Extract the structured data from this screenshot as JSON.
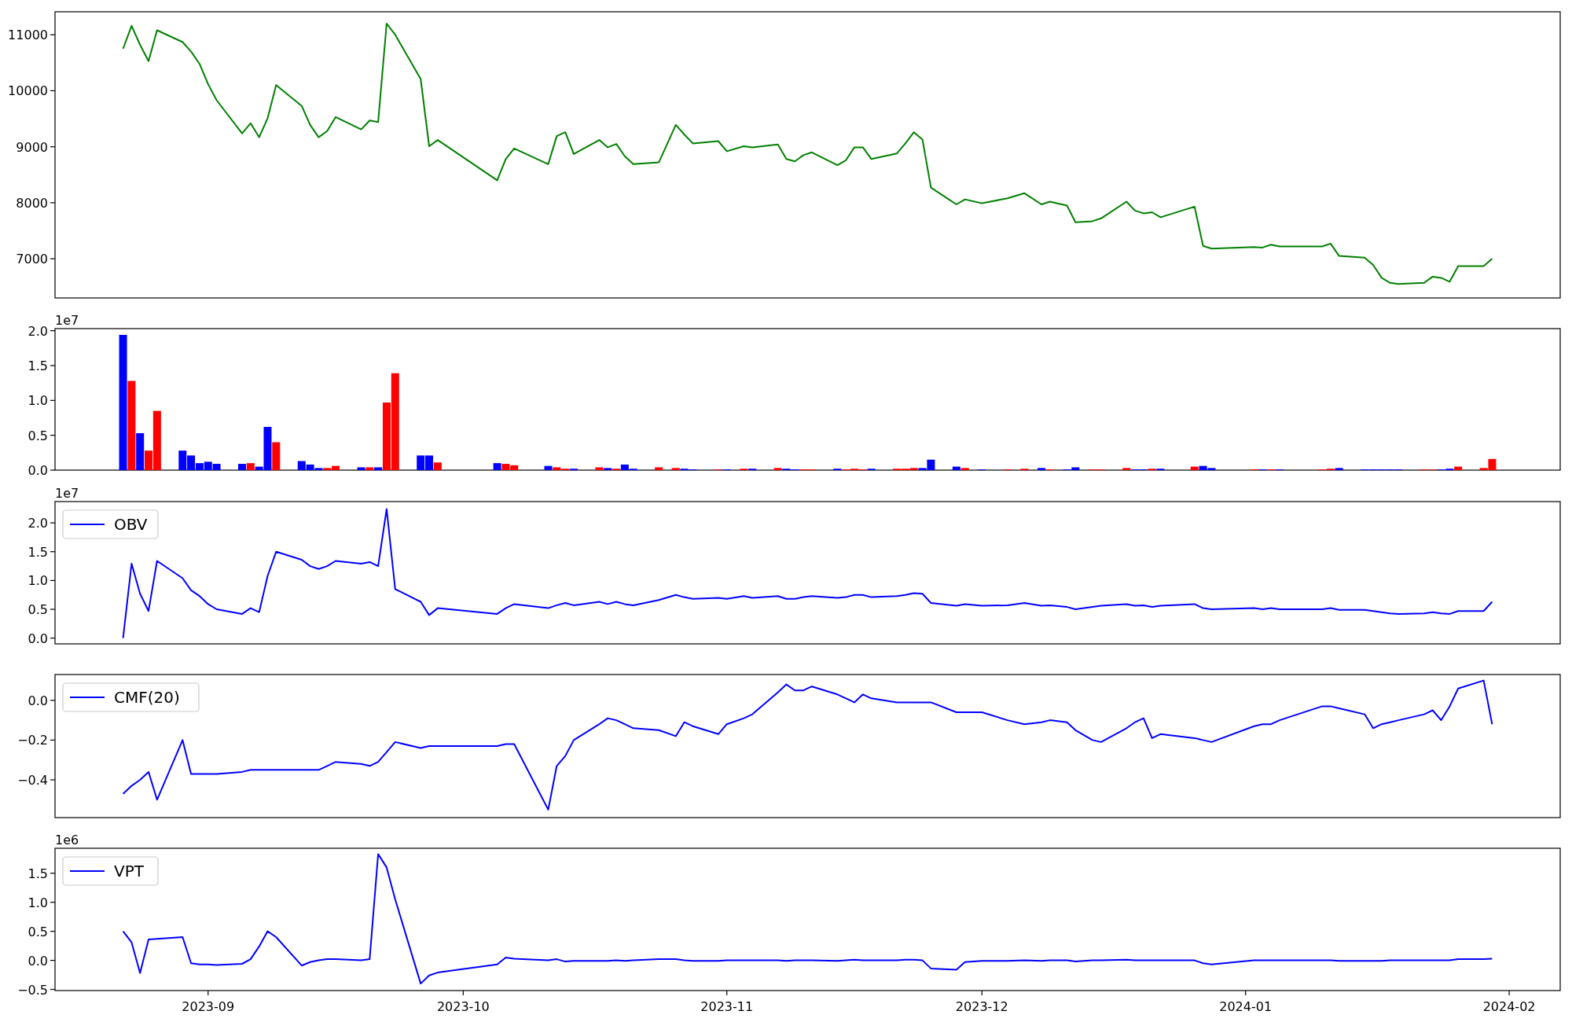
{
  "figure": {
    "panels": [
      {
        "chart_data": {
          "type": "line",
          "xlim": [
            "2023-08-14",
            "2024-02-07"
          ],
          "ylim": [
            6300,
            11410
          ],
          "yticks": [
            7000,
            8000,
            9000,
            10000,
            11000
          ],
          "x": [
            "2023-08-22",
            "2023-08-23",
            "2023-08-24",
            "2023-08-25",
            "2023-08-26",
            "2023-08-29",
            "2023-08-30",
            "2023-08-31",
            "2023-09-01",
            "2023-09-02",
            "2023-09-05",
            "2023-09-06",
            "2023-09-07",
            "2023-09-08",
            "2023-09-09",
            "2023-09-12",
            "2023-09-13",
            "2023-09-14",
            "2023-09-15",
            "2023-09-16",
            "2023-09-19",
            "2023-09-20",
            "2023-09-21",
            "2023-09-22",
            "2023-09-23",
            "2023-09-26",
            "2023-09-27",
            "2023-09-28",
            "2023-10-05",
            "2023-10-06",
            "2023-10-07",
            "2023-10-11",
            "2023-10-12",
            "2023-10-13",
            "2023-10-14",
            "2023-10-17",
            "2023-10-18",
            "2023-10-19",
            "2023-10-20",
            "2023-10-21",
            "2023-10-24",
            "2023-10-26",
            "2023-10-27",
            "2023-10-28",
            "2023-10-31",
            "2023-11-01",
            "2023-11-03",
            "2023-11-04",
            "2023-11-07",
            "2023-11-08",
            "2023-11-09",
            "2023-11-10",
            "2023-11-11",
            "2023-11-14",
            "2023-11-15",
            "2023-11-16",
            "2023-11-17",
            "2023-11-18",
            "2023-11-21",
            "2023-11-22",
            "2023-11-23",
            "2023-11-24",
            "2023-11-25",
            "2023-11-28",
            "2023-11-29",
            "2023-12-01",
            "2023-12-04",
            "2023-12-06",
            "2023-12-08",
            "2023-12-09",
            "2023-12-11",
            "2023-12-12",
            "2023-12-14",
            "2023-12-15",
            "2023-12-18",
            "2023-12-19",
            "2023-12-20",
            "2023-12-21",
            "2023-12-22",
            "2023-12-26",
            "2023-12-27",
            "2023-12-28",
            "2024-01-02",
            "2024-01-03",
            "2024-01-04",
            "2024-01-05",
            "2024-01-10",
            "2024-01-11",
            "2024-01-12",
            "2024-01-15",
            "2024-01-16",
            "2024-01-17",
            "2024-01-18",
            "2024-01-19",
            "2024-01-22",
            "2024-01-23",
            "2024-01-24",
            "2024-01-25",
            "2024-01-26",
            "2024-01-29",
            "2024-01-30"
          ],
          "series": [
            {
              "color": "#008000",
              "values": [
                10750,
                11160,
                10820,
                10530,
                11080,
                10870,
                10700,
                10480,
                10120,
                9830,
                9240,
                9420,
                9170,
                9510,
                10100,
                9730,
                9390,
                9170,
                9280,
                9530,
                9310,
                9470,
                9440,
                11200,
                11000,
                10210,
                9010,
                9120,
                8400,
                8780,
                8970,
                8690,
                9190,
                9260,
                8870,
                9120,
                8990,
                9050,
                8830,
                8690,
                8720,
                9390,
                9220,
                9060,
                9100,
                8920,
                9010,
                8990,
                9040,
                8780,
                8740,
                8850,
                8900,
                8670,
                8760,
                8990,
                8990,
                8780,
                8880,
                9060,
                9260,
                9130,
                8270,
                7970,
                8060,
                7990,
                8080,
                8170,
                7970,
                8020,
                7950,
                7650,
                7670,
                7720,
                8020,
                7860,
                7810,
                7830,
                7740,
                7930,
                7230,
                7180,
                7210,
                7200,
                7250,
                7220,
                7220,
                7270,
                7050,
                7020,
                6890,
                6660,
                6570,
                6550,
                6570,
                6680,
                6660,
                6590,
                6870,
                6870,
                7000
              ]
            }
          ]
        }
      },
      {
        "scale_label": "1e7",
        "chart_data": {
          "type": "bar",
          "xlim": [
            "2023-08-14",
            "2024-02-07"
          ],
          "ylim": [
            0,
            2.03
          ],
          "yticks": [
            {
              "value": 0,
              "label": "0.0"
            },
            {
              "value": 0.5,
              "label": "0.5"
            },
            {
              "value": 1,
              "label": "1.0"
            },
            {
              "value": 1.5,
              "label": "1.5"
            },
            {
              "value": 2,
              "label": "2.0"
            }
          ],
          "x": [
            "2023-08-22",
            "2023-08-23",
            "2023-08-24",
            "2023-08-25",
            "2023-08-26",
            "2023-08-29",
            "2023-08-30",
            "2023-08-31",
            "2023-09-01",
            "2023-09-02",
            "2023-09-05",
            "2023-09-06",
            "2023-09-07",
            "2023-09-08",
            "2023-09-09",
            "2023-09-12",
            "2023-09-13",
            "2023-09-14",
            "2023-09-15",
            "2023-09-16",
            "2023-09-19",
            "2023-09-20",
            "2023-09-21",
            "2023-09-22",
            "2023-09-23",
            "2023-09-26",
            "2023-09-27",
            "2023-09-28",
            "2023-10-05",
            "2023-10-06",
            "2023-10-07",
            "2023-10-11",
            "2023-10-12",
            "2023-10-13",
            "2023-10-14",
            "2023-10-17",
            "2023-10-18",
            "2023-10-19",
            "2023-10-20",
            "2023-10-21",
            "2023-10-24",
            "2023-10-26",
            "2023-10-27",
            "2023-10-28",
            "2023-10-31",
            "2023-11-01",
            "2023-11-03",
            "2023-11-04",
            "2023-11-07",
            "2023-11-08",
            "2023-11-09",
            "2023-11-10",
            "2023-11-11",
            "2023-11-14",
            "2023-11-15",
            "2023-11-16",
            "2023-11-17",
            "2023-11-18",
            "2023-11-21",
            "2023-11-22",
            "2023-11-23",
            "2023-11-24",
            "2023-11-25",
            "2023-11-28",
            "2023-11-29",
            "2023-12-01",
            "2023-12-04",
            "2023-12-06",
            "2023-12-08",
            "2023-12-09",
            "2023-12-11",
            "2023-12-12",
            "2023-12-14",
            "2023-12-15",
            "2023-12-18",
            "2023-12-19",
            "2023-12-20",
            "2023-12-21",
            "2023-12-22",
            "2023-12-26",
            "2023-12-27",
            "2023-12-28",
            "2024-01-02",
            "2024-01-03",
            "2024-01-04",
            "2024-01-05",
            "2024-01-10",
            "2024-01-11",
            "2024-01-12",
            "2024-01-15",
            "2024-01-16",
            "2024-01-17",
            "2024-01-18",
            "2024-01-19",
            "2024-01-22",
            "2024-01-23",
            "2024-01-24",
            "2024-01-25",
            "2024-01-26",
            "2024-01-29",
            "2024-01-30"
          ],
          "series": [
            {
              "color": "#ff0000",
              "values": [
                null,
                1.28,
                null,
                0.28,
                0.85,
                null,
                null,
                null,
                null,
                null,
                null,
                0.1,
                null,
                null,
                0.4,
                null,
                null,
                null,
                0.03,
                0.06,
                null,
                0.04,
                null,
                0.97,
                1.39,
                null,
                null,
                0.11,
                null,
                0.09,
                0.07,
                null,
                0.04,
                0.02,
                null,
                0.04,
                null,
                0.02,
                null,
                null,
                0.04,
                0.03,
                null,
                null,
                0.01,
                null,
                0.02,
                null,
                0.03,
                null,
                null,
                0.01,
                0.01,
                null,
                0.01,
                0.02,
                0.01,
                null,
                0.02,
                0.02,
                0.03,
                null,
                null,
                null,
                0.03,
                null,
                0.01,
                0.02,
                null,
                0.01,
                null,
                null,
                0.01,
                0.01,
                0.03,
                null,
                null,
                0.02,
                null,
                0.05,
                null,
                null,
                0.01,
                null,
                0.01,
                null,
                0.01,
                0.02,
                null,
                null,
                null,
                null,
                null,
                null,
                0.01,
                0.01,
                null,
                null,
                0.05,
                0.03,
                0.16
              ]
            },
            {
              "color": "#0000ff",
              "values": [
                1.94,
                null,
                0.53,
                null,
                null,
                0.28,
                0.21,
                0.1,
                0.12,
                0.09,
                0.09,
                null,
                0.05,
                0.62,
                null,
                0.13,
                0.08,
                0.03,
                null,
                null,
                0.04,
                null,
                0.04,
                null,
                null,
                0.21,
                0.21,
                null,
                0.1,
                null,
                null,
                0.06,
                null,
                null,
                0.02,
                null,
                0.03,
                null,
                0.08,
                0.02,
                null,
                null,
                0.02,
                0.01,
                null,
                0.01,
                null,
                0.02,
                null,
                0.02,
                0.01,
                null,
                null,
                0.02,
                null,
                null,
                null,
                0.02,
                null,
                null,
                null,
                0.03,
                0.15,
                0.05,
                null,
                0.01,
                null,
                null,
                0.03,
                null,
                0.01,
                0.04,
                null,
                null,
                null,
                0.01,
                0.01,
                null,
                0.02,
                null,
                0.06,
                0.03,
                null,
                0.01,
                null,
                0.01,
                null,
                null,
                0.03,
                0.01,
                0.01,
                0.01,
                0.01,
                0.01,
                null,
                null,
                0.01,
                0.02,
                null,
                null,
                null
              ]
            }
          ]
        }
      },
      {
        "scale_label": "1e7",
        "chart_data": {
          "type": "line",
          "xlim": [
            "2023-08-14",
            "2024-02-07"
          ],
          "ylim": [
            -0.1,
            2.37
          ],
          "yticks": [
            {
              "value": 0,
              "label": "0.0"
            },
            {
              "value": 0.5,
              "label": "0.5"
            },
            {
              "value": 1,
              "label": "1.0"
            },
            {
              "value": 1.5,
              "label": "1.5"
            },
            {
              "value": 2,
              "label": "2.0"
            }
          ],
          "x": [
            "2023-08-22",
            "2023-08-23",
            "2023-08-24",
            "2023-08-25",
            "2023-08-26",
            "2023-08-29",
            "2023-08-30",
            "2023-08-31",
            "2023-09-01",
            "2023-09-02",
            "2023-09-05",
            "2023-09-06",
            "2023-09-07",
            "2023-09-08",
            "2023-09-09",
            "2023-09-12",
            "2023-09-13",
            "2023-09-14",
            "2023-09-15",
            "2023-09-16",
            "2023-09-19",
            "2023-09-20",
            "2023-09-21",
            "2023-09-22",
            "2023-09-23",
            "2023-09-26",
            "2023-09-27",
            "2023-09-28",
            "2023-10-05",
            "2023-10-06",
            "2023-10-07",
            "2023-10-11",
            "2023-10-12",
            "2023-10-13",
            "2023-10-14",
            "2023-10-17",
            "2023-10-18",
            "2023-10-19",
            "2023-10-20",
            "2023-10-21",
            "2023-10-24",
            "2023-10-26",
            "2023-10-27",
            "2023-10-28",
            "2023-10-31",
            "2023-11-01",
            "2023-11-03",
            "2023-11-04",
            "2023-11-07",
            "2023-11-08",
            "2023-11-09",
            "2023-11-10",
            "2023-11-11",
            "2023-11-14",
            "2023-11-15",
            "2023-11-16",
            "2023-11-17",
            "2023-11-18",
            "2023-11-21",
            "2023-11-22",
            "2023-11-23",
            "2023-11-24",
            "2023-11-25",
            "2023-11-28",
            "2023-11-29",
            "2023-12-01",
            "2023-12-04",
            "2023-12-06",
            "2023-12-08",
            "2023-12-09",
            "2023-12-11",
            "2023-12-12",
            "2023-12-14",
            "2023-12-15",
            "2023-12-18",
            "2023-12-19",
            "2023-12-20",
            "2023-12-21",
            "2023-12-22",
            "2023-12-26",
            "2023-12-27",
            "2023-12-28",
            "2024-01-02",
            "2024-01-03",
            "2024-01-04",
            "2024-01-05",
            "2024-01-10",
            "2024-01-11",
            "2024-01-12",
            "2024-01-15",
            "2024-01-16",
            "2024-01-17",
            "2024-01-18",
            "2024-01-19",
            "2024-01-22",
            "2024-01-23",
            "2024-01-24",
            "2024-01-25",
            "2024-01-26",
            "2024-01-29",
            "2024-01-30"
          ],
          "series": [
            {
              "name": "OBV",
              "color": "#0000ff",
              "values": [
                0,
                1.29,
                0.77,
                0.47,
                1.34,
                1.04,
                0.83,
                0.73,
                0.59,
                0.5,
                0.42,
                0.52,
                0.45,
                1.08,
                1.5,
                1.36,
                1.25,
                1.2,
                1.25,
                1.34,
                1.29,
                1.32,
                1.25,
                2.24,
                0.85,
                0.63,
                0.4,
                0.52,
                0.42,
                0.52,
                0.59,
                0.52,
                0.57,
                0.61,
                0.57,
                0.63,
                0.59,
                0.63,
                0.59,
                0.57,
                0.66,
                0.75,
                0.71,
                0.68,
                0.7,
                0.68,
                0.73,
                0.7,
                0.73,
                0.68,
                0.68,
                0.71,
                0.73,
                0.7,
                0.71,
                0.75,
                0.75,
                0.71,
                0.73,
                0.75,
                0.78,
                0.77,
                0.61,
                0.56,
                0.59,
                0.56,
                0.57,
                0.61,
                0.56,
                0.57,
                0.54,
                0.5,
                0.54,
                0.56,
                0.59,
                0.56,
                0.57,
                0.54,
                0.56,
                0.59,
                0.52,
                0.5,
                0.52,
                0.5,
                0.52,
                0.5,
                0.5,
                0.52,
                0.49,
                0.49,
                0.47,
                0.45,
                0.43,
                0.42,
                0.43,
                0.45,
                0.43,
                0.42,
                0.47,
                0.47,
                0.63
              ]
            }
          ]
        }
      },
      {
        "chart_data": {
          "type": "line",
          "xlim": [
            "2023-08-14",
            "2024-02-07"
          ],
          "ylim": [
            -0.59,
            0.13
          ],
          "yticks": [
            {
              "value": -0.4,
              "label": "−0.4"
            },
            {
              "value": -0.2,
              "label": "−0.2"
            },
            {
              "value": 0,
              "label": "0.0"
            }
          ],
          "x": [
            "2023-08-22",
            "2023-08-23",
            "2023-08-24",
            "2023-08-25",
            "2023-08-26",
            "2023-08-29",
            "2023-08-30",
            "2023-08-31",
            "2023-09-01",
            "2023-09-02",
            "2023-09-05",
            "2023-09-06",
            "2023-09-07",
            "2023-09-08",
            "2023-09-09",
            "2023-09-12",
            "2023-09-13",
            "2023-09-14",
            "2023-09-15",
            "2023-09-16",
            "2023-09-19",
            "2023-09-20",
            "2023-09-21",
            "2023-09-22",
            "2023-09-23",
            "2023-09-26",
            "2023-09-27",
            "2023-09-28",
            "2023-10-05",
            "2023-10-06",
            "2023-10-07",
            "2023-10-11",
            "2023-10-12",
            "2023-10-13",
            "2023-10-14",
            "2023-10-17",
            "2023-10-18",
            "2023-10-19",
            "2023-10-20",
            "2023-10-21",
            "2023-10-24",
            "2023-10-26",
            "2023-10-27",
            "2023-10-28",
            "2023-10-31",
            "2023-11-01",
            "2023-11-03",
            "2023-11-04",
            "2023-11-07",
            "2023-11-08",
            "2023-11-09",
            "2023-11-10",
            "2023-11-11",
            "2023-11-14",
            "2023-11-15",
            "2023-11-16",
            "2023-11-17",
            "2023-11-18",
            "2023-11-21",
            "2023-11-22",
            "2023-11-23",
            "2023-11-24",
            "2023-11-25",
            "2023-11-28",
            "2023-11-29",
            "2023-12-01",
            "2023-12-04",
            "2023-12-06",
            "2023-12-08",
            "2023-12-09",
            "2023-12-11",
            "2023-12-12",
            "2023-12-14",
            "2023-12-15",
            "2023-12-18",
            "2023-12-19",
            "2023-12-20",
            "2023-12-21",
            "2023-12-22",
            "2023-12-26",
            "2023-12-27",
            "2023-12-28",
            "2024-01-02",
            "2024-01-03",
            "2024-01-04",
            "2024-01-05",
            "2024-01-10",
            "2024-01-11",
            "2024-01-12",
            "2024-01-15",
            "2024-01-16",
            "2024-01-17",
            "2024-01-18",
            "2024-01-19",
            "2024-01-22",
            "2024-01-23",
            "2024-01-24",
            "2024-01-25",
            "2024-01-26",
            "2024-01-29",
            "2024-01-30"
          ],
          "series": [
            {
              "name": "CMF(20)",
              "color": "#0000ff",
              "values": [
                -0.47,
                -0.43,
                -0.4,
                -0.36,
                -0.5,
                -0.2,
                -0.37,
                -0.37,
                -0.37,
                -0.37,
                -0.36,
                -0.35,
                -0.35,
                -0.35,
                -0.35,
                -0.35,
                -0.35,
                -0.35,
                -0.33,
                -0.31,
                -0.32,
                -0.33,
                -0.31,
                -0.26,
                -0.21,
                -0.24,
                -0.23,
                -0.23,
                -0.23,
                -0.22,
                -0.22,
                -0.55,
                -0.33,
                -0.28,
                -0.2,
                -0.12,
                -0.09,
                -0.1,
                -0.12,
                -0.14,
                -0.15,
                -0.18,
                -0.11,
                -0.13,
                -0.17,
                -0.12,
                -0.09,
                -0.07,
                0.04,
                0.08,
                0.05,
                0.05,
                0.07,
                0.03,
                0.01,
                -0.01,
                0.03,
                0.01,
                -0.01,
                -0.01,
                -0.01,
                -0.01,
                -0.01,
                -0.06,
                -0.06,
                -0.06,
                -0.1,
                -0.12,
                -0.11,
                -0.1,
                -0.11,
                -0.15,
                -0.2,
                -0.21,
                -0.14,
                -0.11,
                -0.09,
                -0.19,
                -0.17,
                -0.19,
                -0.2,
                -0.21,
                -0.13,
                -0.12,
                -0.12,
                -0.1,
                -0.03,
                -0.03,
                -0.04,
                -0.07,
                -0.14,
                -0.12,
                -0.11,
                -0.1,
                -0.07,
                -0.05,
                -0.1,
                -0.03,
                0.06,
                0.1,
                -0.12
              ]
            }
          ]
        }
      },
      {
        "scale_label": "1e6",
        "chart_data": {
          "type": "line",
          "xlim": [
            "2023-08-14",
            "2024-02-07"
          ],
          "ylim": [
            -0.52,
            1.93
          ],
          "yticks": [
            {
              "value": -0.5,
              "label": "−0.5"
            },
            {
              "value": 0,
              "label": "0.0"
            },
            {
              "value": 0.5,
              "label": "0.5"
            },
            {
              "value": 1,
              "label": "1.0"
            },
            {
              "value": 1.5,
              "label": "1.5"
            }
          ],
          "xticks": [
            {
              "value": "2023-09-01",
              "label": "2023-09"
            },
            {
              "value": "2023-10-01",
              "label": "2023-10"
            },
            {
              "value": "2023-11-01",
              "label": "2023-11"
            },
            {
              "value": "2023-12-01",
              "label": "2023-12"
            },
            {
              "value": "2024-01-01",
              "label": "2024-01"
            },
            {
              "value": "2024-02-01",
              "label": "2024-02"
            }
          ],
          "x": [
            "2023-08-22",
            "2023-08-23",
            "2023-08-24",
            "2023-08-25",
            "2023-08-26",
            "2023-08-29",
            "2023-08-30",
            "2023-08-31",
            "2023-09-01",
            "2023-09-02",
            "2023-09-05",
            "2023-09-06",
            "2023-09-07",
            "2023-09-08",
            "2023-09-09",
            "2023-09-12",
            "2023-09-13",
            "2023-09-14",
            "2023-09-15",
            "2023-09-16",
            "2023-09-19",
            "2023-09-20",
            "2023-09-21",
            "2023-09-22",
            "2023-09-23",
            "2023-09-26",
            "2023-09-27",
            "2023-09-28",
            "2023-10-05",
            "2023-10-06",
            "2023-10-07",
            "2023-10-11",
            "2023-10-12",
            "2023-10-13",
            "2023-10-14",
            "2023-10-17",
            "2023-10-18",
            "2023-10-19",
            "2023-10-20",
            "2023-10-21",
            "2023-10-24",
            "2023-10-26",
            "2023-10-27",
            "2023-10-28",
            "2023-10-31",
            "2023-11-01",
            "2023-11-03",
            "2023-11-04",
            "2023-11-07",
            "2023-11-08",
            "2023-11-09",
            "2023-11-10",
            "2023-11-11",
            "2023-11-14",
            "2023-11-15",
            "2023-11-16",
            "2023-11-17",
            "2023-11-18",
            "2023-11-21",
            "2023-11-22",
            "2023-11-23",
            "2023-11-24",
            "2023-11-25",
            "2023-11-28",
            "2023-11-29",
            "2023-12-01",
            "2023-12-04",
            "2023-12-06",
            "2023-12-08",
            "2023-12-09",
            "2023-12-11",
            "2023-12-12",
            "2023-12-14",
            "2023-12-15",
            "2023-12-18",
            "2023-12-19",
            "2023-12-20",
            "2023-12-21",
            "2023-12-22",
            "2023-12-26",
            "2023-12-27",
            "2023-12-28",
            "2024-01-02",
            "2024-01-03",
            "2024-01-04",
            "2024-01-05",
            "2024-01-10",
            "2024-01-11",
            "2024-01-12",
            "2024-01-15",
            "2024-01-16",
            "2024-01-17",
            "2024-01-18",
            "2024-01-19",
            "2024-01-22",
            "2024-01-23",
            "2024-01-24",
            "2024-01-25",
            "2024-01-26",
            "2024-01-29",
            "2024-01-30"
          ],
          "series": [
            {
              "name": "VPT",
              "color": "#0000ff",
              "values": [
                0.5,
                0.31,
                -0.22,
                0.36,
                0.37,
                0.4,
                -0.05,
                -0.07,
                -0.07,
                -0.08,
                -0.06,
                0.02,
                0.24,
                0.5,
                0.4,
                -0.09,
                -0.03,
                0.0,
                0.02,
                0.02,
                0.0,
                0.02,
                1.83,
                1.6,
                1.05,
                -0.4,
                -0.26,
                -0.21,
                -0.07,
                0.05,
                0.03,
                0.0,
                0.02,
                -0.02,
                -0.01,
                -0.01,
                -0.01,
                0.0,
                -0.01,
                0.0,
                0.02,
                0.02,
                0.0,
                -0.01,
                -0.01,
                0.0,
                0.0,
                0.0,
                0.0,
                -0.01,
                0.0,
                0.0,
                0.0,
                -0.01,
                0.0,
                0.01,
                0.0,
                0.0,
                0.0,
                0.01,
                0.01,
                0.0,
                -0.14,
                -0.16,
                -0.03,
                -0.01,
                -0.01,
                0.0,
                -0.01,
                0.0,
                0.0,
                -0.02,
                0.0,
                0.0,
                0.01,
                0.0,
                0.0,
                0.0,
                0.0,
                0.0,
                -0.05,
                -0.07,
                0.0,
                0.0,
                0.0,
                0.0,
                0.0,
                0.0,
                -0.01,
                -0.01,
                -0.01,
                -0.01,
                0.0,
                0.0,
                0.0,
                0.0,
                0.0,
                0.0,
                0.02,
                0.02,
                0.03
              ]
            }
          ]
        }
      }
    ]
  }
}
